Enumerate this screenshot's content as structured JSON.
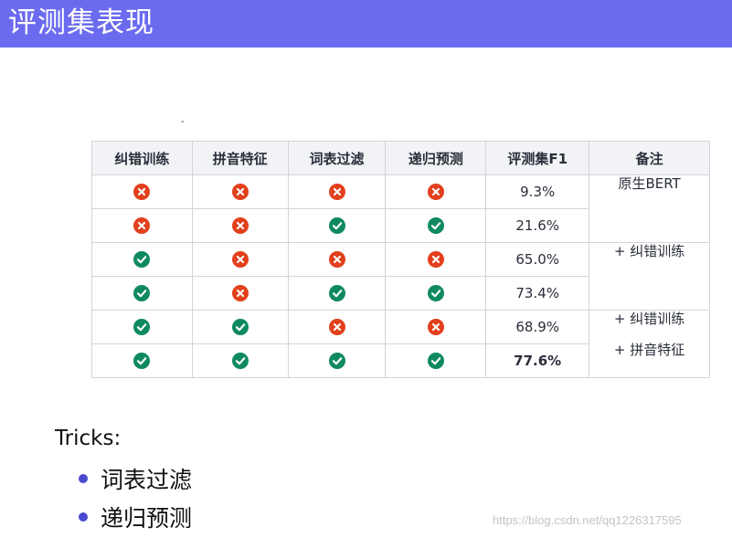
{
  "header": {
    "title": "评测集表现"
  },
  "stray_mark": "-",
  "table": {
    "columns": [
      "纠错训练",
      "拼音特征",
      "词表过滤",
      "递归预测",
      "评测集F1",
      "备注"
    ],
    "rows": [
      {
        "cells": [
          "cross",
          "cross",
          "cross",
          "cross"
        ],
        "f1": "9.3%"
      },
      {
        "cells": [
          "cross",
          "cross",
          "check",
          "check"
        ],
        "f1": "21.6%"
      },
      {
        "cells": [
          "check",
          "cross",
          "cross",
          "cross"
        ],
        "f1": "65.0%"
      },
      {
        "cells": [
          "check",
          "cross",
          "check",
          "check"
        ],
        "f1": "73.4%"
      },
      {
        "cells": [
          "check",
          "check",
          "cross",
          "cross"
        ],
        "f1": "68.9%"
      },
      {
        "cells": [
          "check",
          "check",
          "check",
          "check"
        ],
        "f1": "77.6%"
      }
    ],
    "notes": {
      "group1": "原生BERT",
      "group2": "+ 纠错训练",
      "group3_line1": "+ 纠错训练",
      "group3_line2": "+ 拼音特征"
    }
  },
  "tricks": {
    "label": "Tricks:",
    "items": [
      "词表过滤",
      "递归预测"
    ]
  },
  "watermark": "https://blog.csdn.net/qq1226317595",
  "colors": {
    "header_bg": "#6b6bf0",
    "check": "#0f8a5f",
    "cross": "#e2401c",
    "best_f1": "#2448d8",
    "bullet": "#4a4ad0"
  }
}
